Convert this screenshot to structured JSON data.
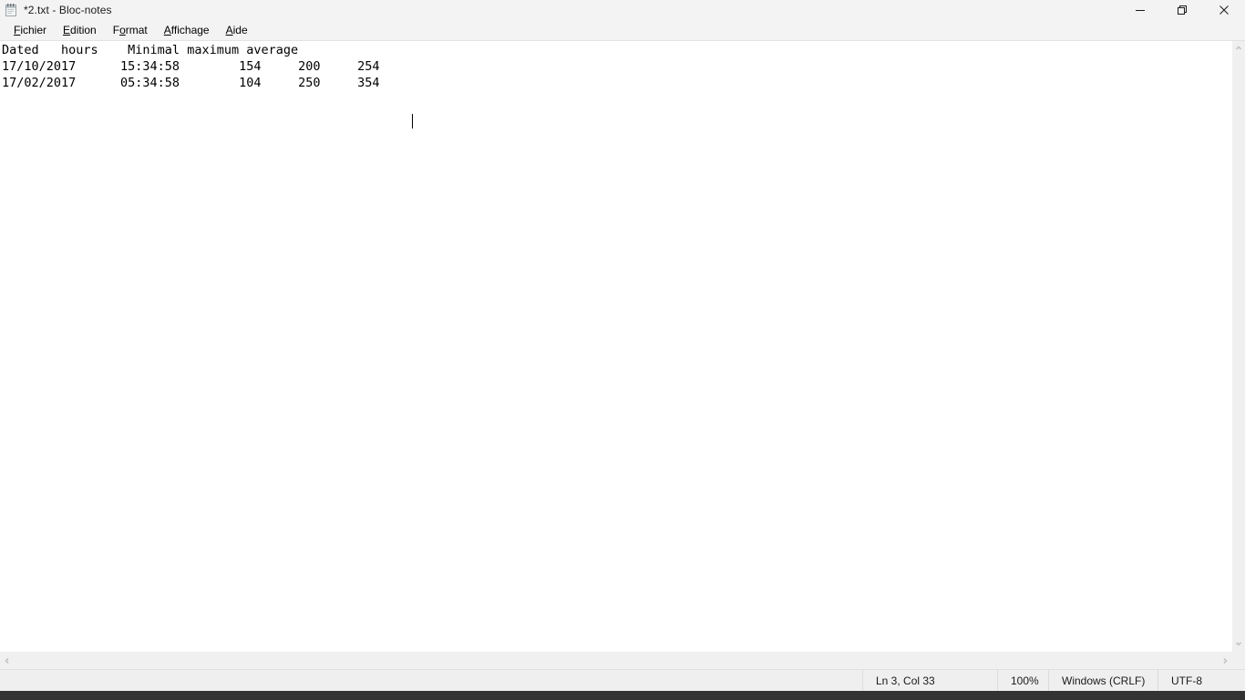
{
  "window": {
    "title": "*2.txt - Bloc-notes",
    "icon": "notepad-icon",
    "controls": {
      "minimize": "minimize-icon",
      "maximize": "restore-icon",
      "close": "close-icon"
    }
  },
  "menubar": {
    "items": [
      {
        "label": "Fichier",
        "accel": "F",
        "accel_index": 0
      },
      {
        "label": "Edition",
        "accel": "E",
        "accel_index": 0
      },
      {
        "label": "Format",
        "accel": "o",
        "accel_index": 1
      },
      {
        "label": "Affichage",
        "accel": "A",
        "accel_index": 0
      },
      {
        "label": "Aide",
        "accel": "A",
        "accel_index": 0
      }
    ]
  },
  "editor": {
    "text": "Dated   hours    Minimal maximum average\n17/10/2017      15:34:58        154     200     254\n17/02/2017      05:34:58        104     250     354     ",
    "lines": [
      "Dated   hours    Minimal maximum average",
      "17/10/2017      15:34:58        154     200     254",
      "17/02/2017      05:34:58        104     250     354     "
    ],
    "table": {
      "headers": [
        "Dated",
        "hours",
        "Minimal",
        "maximum",
        "average"
      ],
      "rows": [
        [
          "17/10/2017",
          "15:34:58",
          "154",
          "200",
          "254"
        ],
        [
          "17/02/2017",
          "05:34:58",
          "104",
          "250",
          "354"
        ]
      ]
    },
    "caret": {
      "line": 3,
      "column": 33
    }
  },
  "scrollbars": {
    "vertical": {
      "up": "chevron-up-icon",
      "down": "chevron-down-icon"
    },
    "horizontal": {
      "left": "chevron-left-icon",
      "right": "chevron-right-icon"
    }
  },
  "statusbar": {
    "position": "Ln 3, Col 33",
    "zoom": "100%",
    "line_ending": "Windows (CRLF)",
    "encoding": "UTF-8"
  }
}
